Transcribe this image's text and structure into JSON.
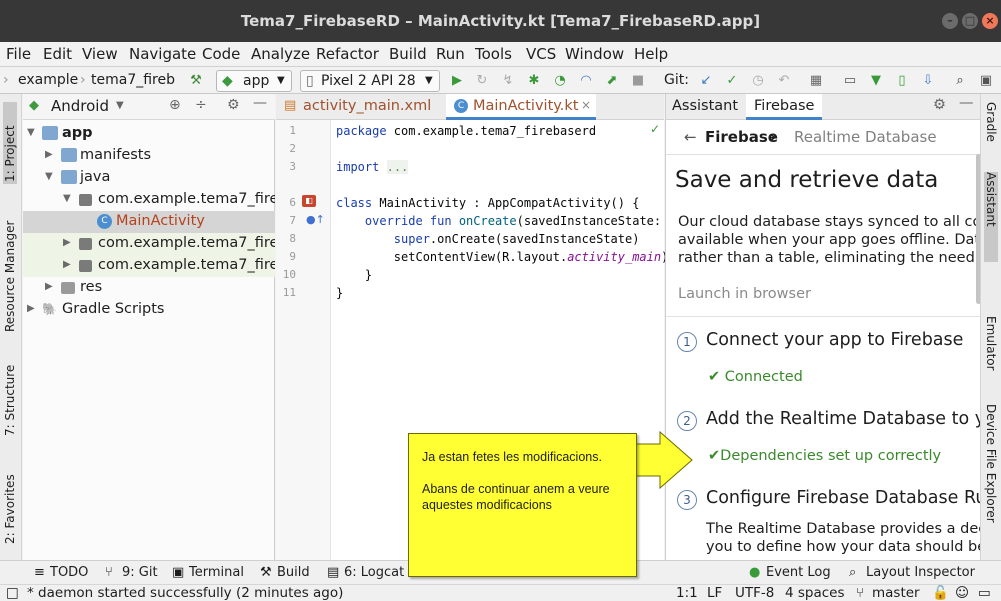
{
  "window": {
    "title": "Tema7_FirebaseRD – MainActivity.kt [Tema7_FirebaseRD.app]",
    "controls": [
      "minimize-icon",
      "maximize-icon",
      "close-icon"
    ]
  },
  "menu": {
    "items": [
      "File",
      "Edit",
      "View",
      "Navigate",
      "Code",
      "Analyze",
      "Refactor",
      "Build",
      "Run",
      "Tools",
      "VCS",
      "Window",
      "Help"
    ]
  },
  "toolbar": {
    "breadcrumb": [
      "example",
      "tema7_fireb"
    ],
    "run_config": "app",
    "device": "Pixel 2 API 28",
    "git_label": "Git:"
  },
  "left_stripe": {
    "tabs": [
      "1: Project",
      "Resource Manager",
      "7: Structure",
      "2: Favorites"
    ]
  },
  "project": {
    "view_selector": "Android",
    "tree": [
      {
        "label": "app",
        "bold": true
      },
      {
        "label": "manifests"
      },
      {
        "label": "java"
      },
      {
        "label": "com.example.tema7_fireb"
      },
      {
        "label": "MainActivity",
        "selected": true
      },
      {
        "label": "com.example.tema7_fireb",
        "test": true
      },
      {
        "label": "com.example.tema7_fireb",
        "test": true
      },
      {
        "label": "res"
      },
      {
        "label": "Gradle Scripts"
      }
    ]
  },
  "editor": {
    "tabs": [
      {
        "label": "activity_main.xml",
        "active": false
      },
      {
        "label": "MainActivity.kt",
        "active": true
      }
    ],
    "line_numbers": [
      "1",
      "2",
      "3",
      "6",
      "7",
      "8",
      "9",
      "10",
      "11"
    ],
    "lines": [
      {
        "n": "1",
        "parts": [
          {
            "t": "package",
            "c": "kw"
          },
          {
            "t": " com.example.tema7_firebaserd",
            "c": ""
          }
        ]
      },
      {
        "n": "3",
        "parts": [
          {
            "t": "import",
            "c": "kw"
          },
          {
            "t": " ",
            "c": ""
          },
          {
            "t": "...",
            "c": "fold"
          }
        ]
      },
      {
        "n": "6",
        "parts": [
          {
            "t": "class",
            "c": "kw"
          },
          {
            "t": " MainActivity : AppCompatActivity() {",
            "c": ""
          }
        ]
      },
      {
        "n": "7",
        "parts": [
          {
            "t": "    override fun",
            "c": "kw"
          },
          {
            "t": " ",
            "c": ""
          },
          {
            "t": "onCreate",
            "c": "fn"
          },
          {
            "t": "(savedInstanceState: B",
            "c": ""
          }
        ]
      },
      {
        "n": "8",
        "parts": [
          {
            "t": "        super",
            "c": "kw"
          },
          {
            "t": ".onCreate(savedInstanceState)",
            "c": ""
          }
        ]
      },
      {
        "n": "9",
        "parts": [
          {
            "t": "        setContentView(R.layout.",
            "c": ""
          },
          {
            "t": "activity_main",
            "c": "it"
          },
          {
            "t": ")",
            "c": ""
          }
        ]
      },
      {
        "n": "10",
        "parts": [
          {
            "t": "    }",
            "c": ""
          }
        ]
      },
      {
        "n": "11",
        "parts": [
          {
            "t": "}",
            "c": ""
          }
        ]
      }
    ]
  },
  "assistant": {
    "tabs": [
      "Assistant",
      "Firebase"
    ],
    "nav_back": "Firebase",
    "nav_current": "Realtime Database",
    "heading": "Save and retrieve data",
    "intro_lines": [
      "Our cloud database stays synced to all conne",
      "available when your app goes offline. Data is",
      "rather than a table, eliminating the need for"
    ],
    "launch_link": "Launch in browser",
    "steps": [
      {
        "num": "1",
        "title": "Connect your app to Firebase",
        "status": "Connected"
      },
      {
        "num": "2",
        "title": "Add the Realtime Database to you",
        "status": "Dependencies set up correctly"
      },
      {
        "num": "3",
        "title": "Configure Firebase Database Rule",
        "status": ""
      }
    ],
    "step3_lines": [
      "The Realtime Database provides a declar",
      "you to define how your data should be st"
    ]
  },
  "right_stripe": {
    "tabs": [
      "Gradle",
      "Assistant",
      "Emulator",
      "Device File Explorer"
    ]
  },
  "bottom_bar": {
    "left": [
      "TODO",
      "9: Git",
      "Terminal",
      "Build",
      "6: Logcat"
    ],
    "right": [
      "Event Log",
      "Layout Inspector"
    ]
  },
  "status_bar": {
    "message": "* daemon started successfully (2 minutes ago)",
    "position": "1:1",
    "line_sep": "LF",
    "encoding": "UTF-8",
    "indent": "4 spaces",
    "branch": "master"
  },
  "callout": {
    "line1": "Ja estan fetes les modificacions.",
    "line2": "Abans de continuar anem a veure",
    "line3": "aquestes modificacions"
  },
  "colors": {
    "accent_blue": "#4083c9",
    "success_green": "#3a8a2c",
    "callout_yellow": "#ffff33",
    "selection_row": "#d5d5d5",
    "test_pkg_bg": "#eef5e6"
  }
}
